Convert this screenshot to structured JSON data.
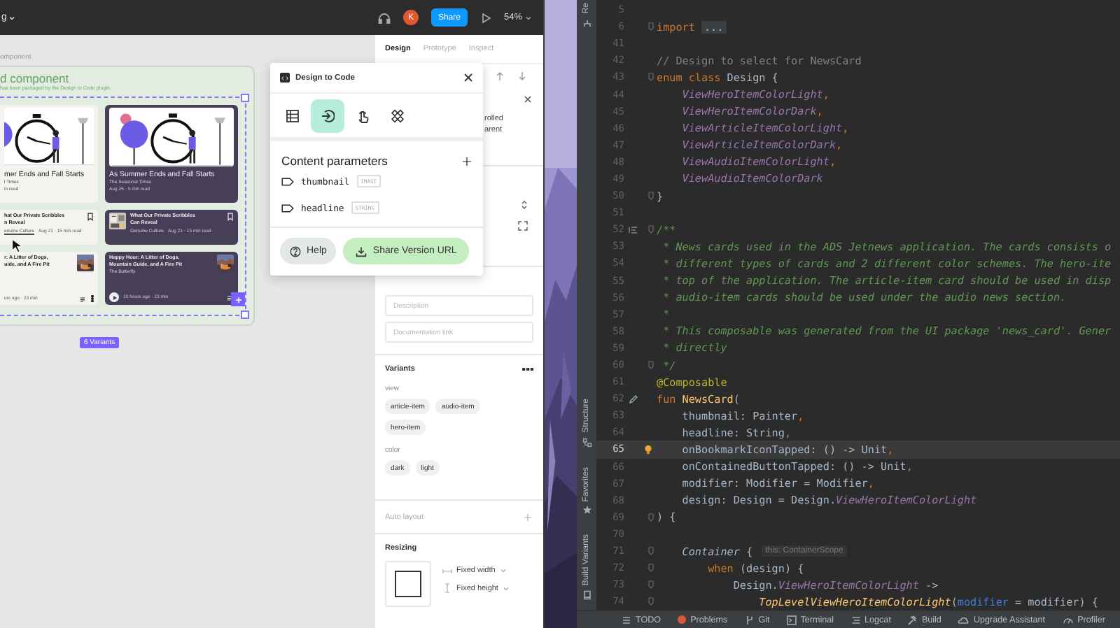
{
  "figma": {
    "toolbar": {
      "file_name": "g",
      "avatar": "K",
      "share_button": "Share",
      "zoom": "54%"
    },
    "canvas": {
      "frame_label": "omponent",
      "frame_title": "d component",
      "frame_subtitle": "has been packaged by the Design to Code plugin.",
      "variants_badge": "6 Variants",
      "cards": [
        {
          "kind": "hero",
          "dark": false,
          "title": "mer Ends and Fall Starts",
          "source": "l Times",
          "meta": "in read"
        },
        {
          "kind": "hero",
          "dark": true,
          "title": "As Summer Ends and Fall Starts",
          "source": "The Seasonal Times",
          "meta": "Aug 25 · 5 min read"
        },
        {
          "kind": "article",
          "dark": false,
          "title": "hat Our Private Scribbles\nn Reveal",
          "source": "enuine Culture",
          "source_hovered": true,
          "meta": "Aug 21 · 15 min read"
        },
        {
          "kind": "article",
          "dark": true,
          "title": "What Our Private Scribbles\nCan Reveal",
          "source": "Genuine Culture",
          "source_hovered": false,
          "meta": "Aug 21 · 15 min read"
        },
        {
          "kind": "audio",
          "dark": false,
          "title": "r: A Litter of Dogs,\nuide, and A Fire Pit",
          "meta": "urs ago · 23 min"
        },
        {
          "kind": "audio",
          "dark": true,
          "title": "Happy Hour: A Litter of Dogs,\nMountain Guide, and A Fire Pit",
          "source": "The Butterfly",
          "meta": "10 hours ago · 23 min"
        }
      ]
    },
    "plugin": {
      "title": "Design to Code",
      "tabs": [
        {
          "selected": false
        },
        {
          "selected": true
        },
        {
          "selected": false
        },
        {
          "selected": false
        }
      ],
      "section_title": "Content parameters",
      "parameters": [
        {
          "name": "thumbnail",
          "type": "IMAGE"
        },
        {
          "name": "headline",
          "type": "STRING"
        }
      ],
      "help_button": "Help",
      "share_button": "Share Version URL"
    },
    "panel": {
      "tabs": [
        {
          "label": "Design",
          "selected": true
        },
        {
          "label": "Prototype",
          "selected": false
        },
        {
          "label": "Inspect",
          "selected": false
        }
      ],
      "partial_text": [
        "rolled",
        "arent"
      ],
      "description": {
        "placeholder": "Description"
      },
      "documentation_link": {
        "placeholder": "Documentation link"
      },
      "variants": {
        "title": "Variants",
        "properties": [
          {
            "name": "view",
            "values": [
              "article-item",
              "audio-item",
              "hero-item"
            ]
          },
          {
            "name": "color",
            "values": [
              "dark",
              "light"
            ]
          }
        ]
      },
      "auto_layout": {
        "title": "Auto layout"
      },
      "resizing": {
        "title": "Resizing",
        "width": "Fixed width",
        "height": "Fixed height"
      }
    }
  },
  "ide": {
    "side_tabs": [
      {
        "label": "Re"
      },
      {
        "label": "Structure"
      },
      {
        "label": "Favorites"
      },
      {
        "label": "Build Variants"
      }
    ],
    "lines": [
      {
        "number": "5",
        "current": false,
        "fold": false
      },
      {
        "number": "6",
        "current": false,
        "fold": true,
        "tokens": [
          {
            "kind": "kw",
            "text": "import"
          },
          {
            "kind": "folded",
            "text": "..."
          }
        ]
      },
      {
        "number": "41",
        "current": false,
        "fold": false
      },
      {
        "number": "42",
        "current": false,
        "fold": false,
        "tokens": [
          {
            "kind": "comment",
            "text": "// Design to select for NewsCard"
          }
        ]
      },
      {
        "number": "43",
        "current": false,
        "fold": true,
        "tokens": [
          {
            "kind": "kw",
            "text": "enum class"
          },
          {
            "kind": "plain",
            "text": " Design {"
          }
        ]
      },
      {
        "number": "44",
        "current": false,
        "fold": false,
        "tokens": [
          {
            "kind": "enum",
            "text": "    ViewHeroItemColorLight"
          },
          {
            "kind": "kw",
            "text": ","
          }
        ]
      },
      {
        "number": "45",
        "current": false,
        "fold": false,
        "tokens": [
          {
            "kind": "enum",
            "text": "    ViewHeroItemColorDark"
          },
          {
            "kind": "kw",
            "text": ","
          }
        ]
      },
      {
        "number": "46",
        "current": false,
        "fold": false,
        "tokens": [
          {
            "kind": "enum",
            "text": "    ViewArticleItemColorLight"
          },
          {
            "kind": "kw",
            "text": ","
          }
        ]
      },
      {
        "number": "47",
        "current": false,
        "fold": false,
        "tokens": [
          {
            "kind": "enum",
            "text": "    ViewArticleItemColorDark"
          },
          {
            "kind": "kw",
            "text": ","
          }
        ]
      },
      {
        "number": "48",
        "current": false,
        "fold": false,
        "tokens": [
          {
            "kind": "enum",
            "text": "    ViewAudioItemColorLight"
          },
          {
            "kind": "kw",
            "text": ","
          }
        ]
      },
      {
        "number": "49",
        "current": false,
        "fold": false,
        "tokens": [
          {
            "kind": "enum",
            "text": "    ViewAudioItemColorDark"
          }
        ]
      },
      {
        "number": "50",
        "current": false,
        "fold": true,
        "tokens": [
          {
            "kind": "plain",
            "text": "}"
          }
        ]
      },
      {
        "number": "51",
        "current": false,
        "fold": false
      },
      {
        "number": "52",
        "current": false,
        "fold": true,
        "gutter_icon": {
          "kind": "impl"
        },
        "tokens": [
          {
            "kind": "doc",
            "text": "/**"
          }
        ]
      },
      {
        "number": "53",
        "current": false,
        "fold": false,
        "tokens": [
          {
            "kind": "doc",
            "text": " * News cards used in the ADS Jetnews application. The cards consists o"
          }
        ]
      },
      {
        "number": "54",
        "current": false,
        "fold": false,
        "tokens": [
          {
            "kind": "doc",
            "text": " * different types of cards and 2 different color schemes. The hero-ite"
          }
        ]
      },
      {
        "number": "55",
        "current": false,
        "fold": false,
        "tokens": [
          {
            "kind": "doc",
            "text": " * top of the application. The article-item card should be used in disp"
          }
        ]
      },
      {
        "number": "56",
        "current": false,
        "fold": false,
        "tokens": [
          {
            "kind": "doc",
            "text": " * audio-item cards should be used under the audio news section."
          }
        ]
      },
      {
        "number": "57",
        "current": false,
        "fold": false,
        "tokens": [
          {
            "kind": "doc",
            "text": " *"
          }
        ]
      },
      {
        "number": "58",
        "current": false,
        "fold": false,
        "tokens": [
          {
            "kind": "doc",
            "text": " * This composable was generated from the UI package 'news_card'. Gener"
          }
        ]
      },
      {
        "number": "59",
        "current": false,
        "fold": false,
        "tokens": [
          {
            "kind": "doc",
            "text": " * directly"
          }
        ]
      },
      {
        "number": "60",
        "current": false,
        "fold": true,
        "tokens": [
          {
            "kind": "doc",
            "text": " */"
          }
        ]
      },
      {
        "number": "61",
        "current": false,
        "fold": false,
        "tokens": [
          {
            "kind": "ann",
            "text": "@Composable"
          }
        ]
      },
      {
        "number": "62",
        "current": false,
        "fold": false,
        "gutter_icon": {
          "kind": "edit"
        },
        "tokens": [
          {
            "kind": "kw",
            "text": "fun"
          },
          {
            "kind": "fn",
            "text": "NewsCard"
          },
          {
            "kind": "plain",
            "text": "("
          }
        ]
      },
      {
        "number": "63",
        "current": false,
        "fold": false,
        "tokens": [
          {
            "kind": "plain",
            "text": "    thumbnail: Painter"
          },
          {
            "kind": "kw",
            "text": ","
          }
        ]
      },
      {
        "number": "64",
        "current": false,
        "fold": false,
        "tokens": [
          {
            "kind": "plain",
            "text": "    headline: String"
          },
          {
            "kind": "kw",
            "text": ","
          }
        ]
      },
      {
        "number": "65",
        "current": true,
        "fold": false,
        "gutter_icon": {
          "kind": "bulb"
        },
        "tokens": [
          {
            "kind": "plain",
            "text": "    onBookmarkIconTapped: () -> Unit"
          },
          {
            "kind": "kw",
            "text": ","
          }
        ]
      },
      {
        "number": "66",
        "current": false,
        "fold": false,
        "tokens": [
          {
            "kind": "plain",
            "text": "    onContainedButtonTapped: () -> Unit"
          },
          {
            "kind": "kw",
            "text": ","
          }
        ]
      },
      {
        "number": "67",
        "current": false,
        "fold": false,
        "tokens": [
          {
            "kind": "plain",
            "text": "    modifier: Modifier = Modifier"
          },
          {
            "kind": "kw",
            "text": ","
          }
        ]
      },
      {
        "number": "68",
        "current": false,
        "fold": false,
        "tokens": [
          {
            "kind": "plain",
            "text": "    design: Design = Design."
          },
          {
            "kind": "enum",
            "text": "ViewHeroItemColorLight"
          }
        ]
      },
      {
        "number": "69",
        "current": false,
        "fold": true,
        "tokens": [
          {
            "kind": "plain",
            "text": ") {"
          }
        ]
      },
      {
        "number": "70",
        "current": false,
        "fold": false
      },
      {
        "number": "71",
        "current": false,
        "fold": true,
        "tokens": [
          {
            "kind": "call",
            "text": "    Container"
          },
          {
            "kind": "plain",
            "text": " {"
          },
          {
            "kind": "hint",
            "text": "this: ContainerScope"
          }
        ]
      },
      {
        "number": "72",
        "current": false,
        "fold": true,
        "tokens": [
          {
            "kind": "kw",
            "text": "        when"
          },
          {
            "kind": "plain",
            "text": " (design) {"
          }
        ]
      },
      {
        "number": "73",
        "current": false,
        "fold": true,
        "tokens": [
          {
            "kind": "plain",
            "text": "            Design."
          },
          {
            "kind": "enum",
            "text": "ViewHeroItemColorLight"
          },
          {
            "kind": "plain",
            "text": " ->"
          }
        ]
      },
      {
        "number": "74",
        "current": false,
        "fold": true,
        "tokens": [
          {
            "kind": "callfn",
            "text": "                TopLevelViewHeroItemColorLight"
          },
          {
            "kind": "plain",
            "text": "("
          },
          {
            "kind": "named",
            "text": "modifier"
          },
          {
            "kind": "plain",
            "text": " = modifier) {"
          }
        ]
      }
    ],
    "bottom_tabs": [
      {
        "label": "TODO"
      },
      {
        "label": "Problems"
      },
      {
        "label": "Git"
      },
      {
        "label": "Terminal"
      },
      {
        "label": "Logcat"
      },
      {
        "label": "Build"
      },
      {
        "label": "Upgrade Assistant"
      },
      {
        "label": "Profiler"
      }
    ]
  }
}
